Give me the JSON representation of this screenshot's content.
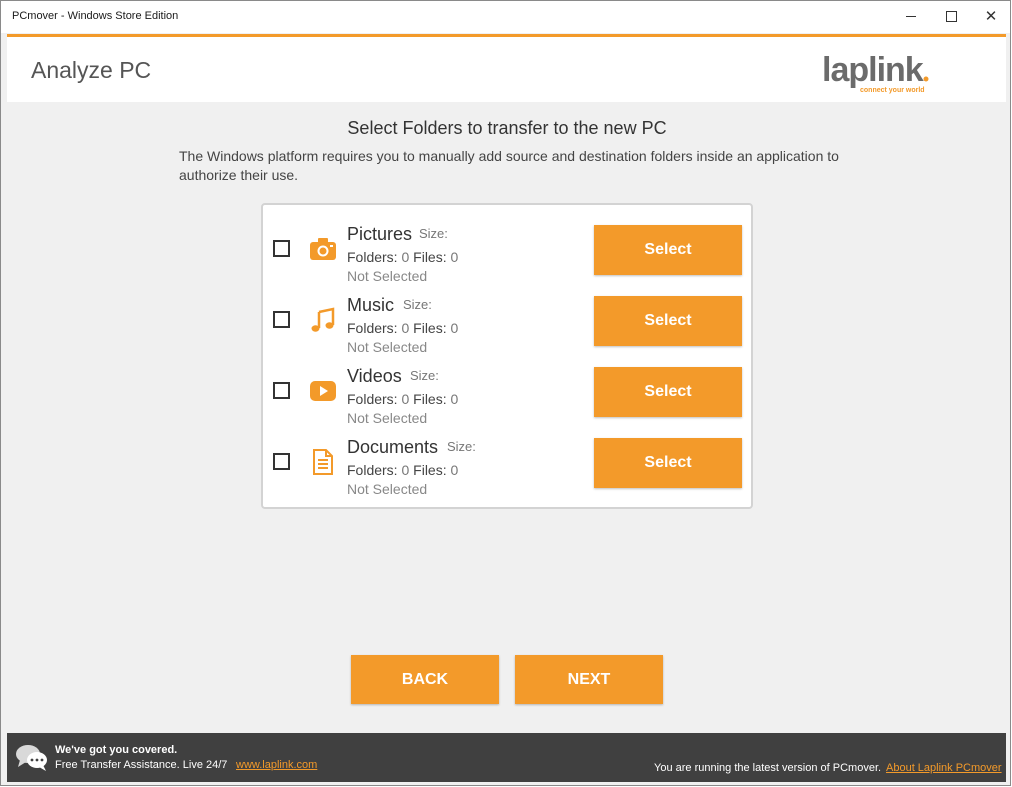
{
  "window": {
    "title": "PCmover - Windows Store Edition"
  },
  "header": {
    "title": "Analyze PC",
    "logo_text": "laplink",
    "logo_tagline": "connect your world"
  },
  "main": {
    "heading": "Select Folders to transfer to the new PC",
    "description": "The Windows platform requires you to manually add source and destination folders inside an application to authorize their use.",
    "folders": [
      {
        "name": "Pictures",
        "size_label": "Size:",
        "folders_label": "Folders:",
        "folders_count": "0",
        "files_label": "Files:",
        "files_count": "0",
        "status": "Not Selected",
        "button": "Select",
        "icon": "camera-icon",
        "checked": false
      },
      {
        "name": "Music",
        "size_label": "Size:",
        "folders_label": "Folders:",
        "folders_count": "0",
        "files_label": "Files:",
        "files_count": "0",
        "status": "Not Selected",
        "button": "Select",
        "icon": "music-note-icon",
        "checked": false
      },
      {
        "name": "Videos",
        "size_label": "Size:",
        "folders_label": "Folders:",
        "folders_count": "0",
        "files_label": "Files:",
        "files_count": "0",
        "status": "Not Selected",
        "button": "Select",
        "icon": "play-icon",
        "checked": false
      },
      {
        "name": "Documents",
        "size_label": "Size:",
        "folders_label": "Folders:",
        "folders_count": "0",
        "files_label": "Files:",
        "files_count": "0",
        "status": "Not Selected",
        "button": "Select",
        "icon": "document-icon",
        "checked": false
      }
    ]
  },
  "nav": {
    "back": "BACK",
    "next": "NEXT"
  },
  "footer": {
    "covered": "We've got you covered.",
    "assistance": "Free Transfer Assistance. Live 24/7",
    "link": "www.laplink.com",
    "version": "You are running the latest version of PCmover.",
    "about": "About Laplink PCmover"
  },
  "colors": {
    "accent": "#f39a2a",
    "footer_bg": "#404040",
    "page_bg": "#f0f0f0"
  }
}
